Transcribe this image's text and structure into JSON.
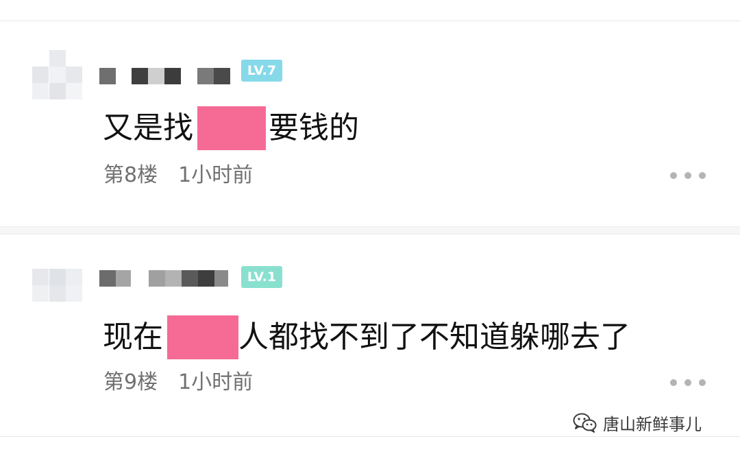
{
  "comments": [
    {
      "level_badge": "LV.7",
      "content_before": "又是找",
      "content_after": "要钱的",
      "floor": "第8楼",
      "time": "1小时前"
    },
    {
      "level_badge": "LV.1",
      "content_before": "现在",
      "content_after": "人都找不到了不知道躲哪去了",
      "floor": "第9楼",
      "time": "1小时前"
    }
  ],
  "watermark": {
    "text": "唐山新鲜事儿",
    "icon": "wechat-icon"
  },
  "colors": {
    "redaction": "#f56b95",
    "badge_lv7": "#86d9e8",
    "badge_lv1": "#89e0cf",
    "meta_text": "#707070",
    "more_dots": "#b4b4b4"
  }
}
